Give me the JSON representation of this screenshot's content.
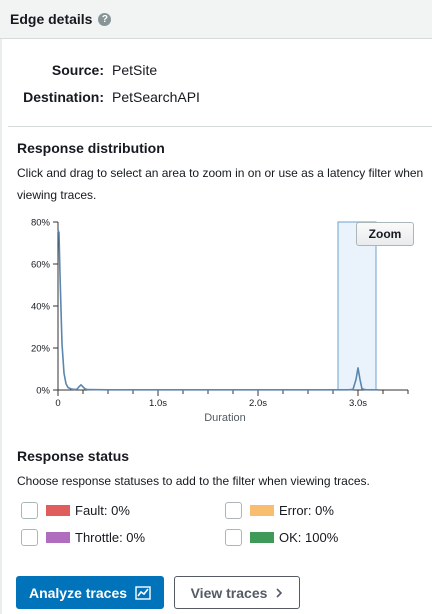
{
  "panel": {
    "title": "Edge details",
    "help_icon": "?"
  },
  "edge": {
    "source_label": "Source:",
    "source_value": "PetSite",
    "destination_label": "Destination:",
    "destination_value": "PetSearchAPI"
  },
  "distribution": {
    "title": "Response distribution",
    "description_line1": "Click and drag to select an area to zoom in on or use as a latency filter when",
    "description_line2": "viewing traces.",
    "zoom_label": "Zoom"
  },
  "chart_data": {
    "type": "line",
    "xlabel": "Duration",
    "xlim": [
      0,
      3.5
    ],
    "ylim": [
      0,
      80
    ],
    "x_ticks": [
      {
        "value": 0,
        "label": "0"
      },
      {
        "value": 1,
        "label": "1.0s"
      },
      {
        "value": 2,
        "label": "2.0s"
      },
      {
        "value": 3,
        "label": "3.0s"
      }
    ],
    "y_ticks": [
      {
        "value": 0,
        "label": "0%"
      },
      {
        "value": 20,
        "label": "20%"
      },
      {
        "value": 40,
        "label": "40%"
      },
      {
        "value": 60,
        "label": "60%"
      },
      {
        "value": 80,
        "label": "80%"
      }
    ],
    "x": [
      0,
      0.01,
      0.02,
      0.04,
      0.06,
      0.08,
      0.1,
      0.13,
      0.16,
      0.19,
      0.21,
      0.23,
      0.25,
      0.27,
      0.3,
      0.5,
      1.0,
      1.5,
      2.0,
      2.5,
      2.9,
      2.95,
      2.98,
      3.0,
      3.02,
      3.04,
      3.08,
      3.2
    ],
    "y": [
      76,
      75,
      55,
      22,
      8,
      3,
      1.2,
      0.5,
      0.3,
      0.4,
      1.5,
      2.5,
      1.5,
      0.5,
      0.2,
      0.1,
      0.1,
      0.1,
      0.1,
      0.1,
      0.1,
      0.3,
      5,
      10.5,
      5,
      0.5,
      0.1,
      0.1
    ],
    "color": "#5a86b0",
    "selection_range": [
      2.8,
      3.18
    ]
  },
  "status": {
    "title": "Response status",
    "description": "Choose response statuses to add to the filter when viewing traces.",
    "items": [
      {
        "label": "Fault: 0%",
        "color": "#e05d5d"
      },
      {
        "label": "Error: 0%",
        "color": "#f8bd6f"
      },
      {
        "label": "Throttle: 0%",
        "color": "#b06dbd"
      },
      {
        "label": "OK: 100%",
        "color": "#3f9a5a"
      }
    ]
  },
  "actions": {
    "analyze_label": "Analyze traces",
    "view_label": "View traces"
  }
}
